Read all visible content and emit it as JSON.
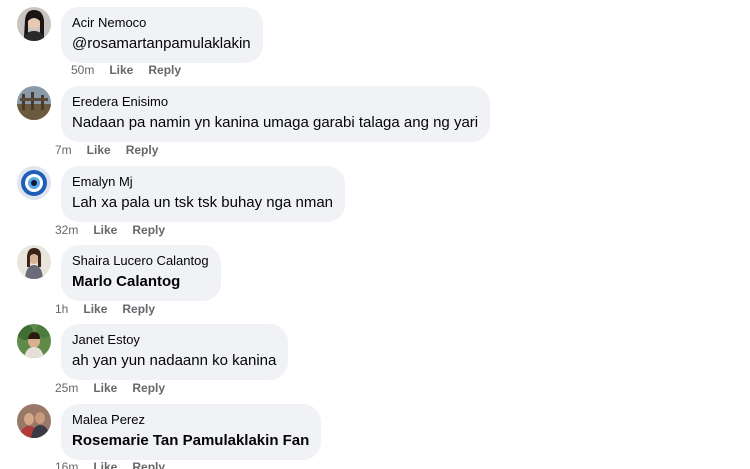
{
  "comments": [
    {
      "author": "Acir Nemoco",
      "text": "@rosamartanpamulaklakin",
      "time": "50m",
      "like": "Like",
      "reply": "Reply"
    },
    {
      "author": "Eredera Enisimo",
      "text": "Nadaan pa namin yn kanina umaga garabi talaga ang ng yari",
      "time": "7m",
      "like": "Like",
      "reply": "Reply"
    },
    {
      "author": "Emalyn Mj",
      "text": "Lah xa pala un tsk tsk buhay nga nman",
      "time": "32m",
      "like": "Like",
      "reply": "Reply"
    },
    {
      "author": "Shaira Lucero Calantog",
      "text": "Marlo Calantog",
      "time": "1h",
      "like": "Like",
      "reply": "Reply"
    },
    {
      "author": "Janet Estoy",
      "text": "ah yan yun nadaann ko kanina",
      "time": "25m",
      "like": "Like",
      "reply": "Reply"
    },
    {
      "author": "Malea Perez",
      "text": "Rosemarie Tan Pamulaklakin Fan",
      "time": "16m",
      "like": "Like",
      "reply": "Reply"
    }
  ]
}
